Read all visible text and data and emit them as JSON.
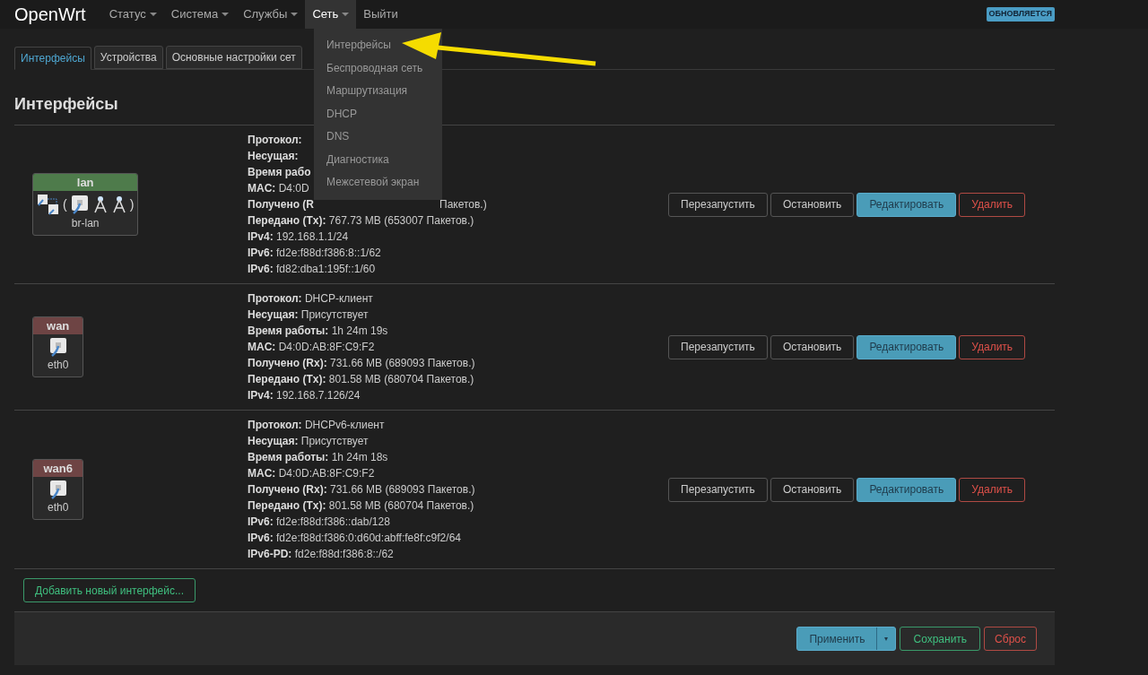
{
  "nav": {
    "brand": "OpenWrt",
    "menus": [
      {
        "label": "Статус",
        "caret": true,
        "open": false
      },
      {
        "label": "Система",
        "caret": true,
        "open": false
      },
      {
        "label": "Службы",
        "caret": true,
        "open": false
      },
      {
        "label": "Сеть",
        "caret": true,
        "open": true
      },
      {
        "label": "Выйти",
        "caret": false,
        "open": false
      }
    ],
    "badge": "ОБНОВЛЯЕТСЯ"
  },
  "dropdown": [
    "Интерфейсы",
    "Беспроводная сеть",
    "Маршрутизация",
    "DHCP",
    "DNS",
    "Диагностика",
    "Межсетевой экран"
  ],
  "tabs": [
    {
      "label": "Интерфейсы",
      "selected": true
    },
    {
      "label": "Устройства",
      "selected": false
    },
    {
      "label": "Основные настройки сет",
      "selected": false
    }
  ],
  "heading": "Интерфейсы",
  "interfaces": [
    {
      "name": "lan",
      "color": "#4e7b4b",
      "device": "br-lan",
      "icons": [
        {
          "kind": "bridge"
        },
        {
          "kind": "paren",
          "text": "("
        },
        {
          "kind": "ethernet"
        },
        {
          "kind": "wifi"
        },
        {
          "kind": "wifi"
        },
        {
          "kind": "paren",
          "text": ")"
        }
      ],
      "info": [
        {
          "label": "Протокол:"
        },
        {
          "label": "Несущая:"
        },
        {
          "label": "Время рабо"
        },
        {
          "label": "MAC:",
          "value": "D4:0D"
        },
        {
          "label": "Получено (R",
          "tail": "Пакетов.)"
        },
        {
          "label": "Передано (Tx):",
          "value": "767.73 MB (653007 Пакетов.)"
        },
        {
          "label": "IPv4:",
          "value": "192.168.1.1/24"
        },
        {
          "label": "IPv6:",
          "value": "fd2e:f88d:f386:8::1/62"
        },
        {
          "label": "IPv6:",
          "value": "fd82:dba1:195f::1/60"
        }
      ]
    },
    {
      "name": "wan",
      "color": "#6e4444",
      "device": "eth0",
      "icons": [
        {
          "kind": "ethernet"
        }
      ],
      "info": [
        {
          "label": "Протокол:",
          "value": "DHCP-клиент"
        },
        {
          "label": "Несущая:",
          "value": "Присутствует"
        },
        {
          "label": "Время работы:",
          "value": "1h 24m 19s"
        },
        {
          "label": "MAC:",
          "value": "D4:0D:AB:8F:C9:F2"
        },
        {
          "label": "Получено (Rx):",
          "value": "731.66 MB (689093 Пакетов.)"
        },
        {
          "label": "Передано (Tx):",
          "value": "801.58 MB (680704 Пакетов.)"
        },
        {
          "label": "IPv4:",
          "value": "192.168.7.126/24"
        }
      ]
    },
    {
      "name": "wan6",
      "color": "#6e4444",
      "device": "eth0",
      "icons": [
        {
          "kind": "ethernet"
        }
      ],
      "info": [
        {
          "label": "Протокол:",
          "value": "DHCPv6-клиент"
        },
        {
          "label": "Несущая:",
          "value": "Присутствует"
        },
        {
          "label": "Время работы:",
          "value": "1h 24m 18s"
        },
        {
          "label": "MAC:",
          "value": "D4:0D:AB:8F:C9:F2"
        },
        {
          "label": "Получено (Rx):",
          "value": "731.66 MB (689093 Пакетов.)"
        },
        {
          "label": "Передано (Tx):",
          "value": "801.58 MB (680704 Пакетов.)"
        },
        {
          "label": "IPv6:",
          "value": "fd2e:f88d:f386::dab/128"
        },
        {
          "label": "IPv6:",
          "value": "fd2e:f88d:f386:0:d60d:abff:fe8f:c9f2/64"
        },
        {
          "label": "IPv6-PD:",
          "value": "fd2e:f88d:f386:8::/62"
        }
      ]
    }
  ],
  "row_buttons": [
    [
      {
        "label": "Перезапустить",
        "kind": "default"
      },
      {
        "label": "Остановить",
        "kind": "default"
      },
      {
        "label": "Редактировать",
        "kind": "primary"
      },
      {
        "label": "Удалить",
        "kind": "danger"
      }
    ],
    [
      {
        "label": "Перезапустить",
        "kind": "default"
      },
      {
        "label": "Остановить",
        "kind": "default"
      },
      {
        "label": "Редактировать",
        "kind": "primary"
      },
      {
        "label": "Удалить",
        "kind": "danger"
      }
    ],
    [
      {
        "label": "Перезапустить",
        "kind": "default"
      },
      {
        "label": "Остановить",
        "kind": "default"
      },
      {
        "label": "Редактировать",
        "kind": "primary"
      },
      {
        "label": "Удалить",
        "kind": "danger"
      }
    ]
  ],
  "add_button": "Добавить новый интерфейс...",
  "footer": {
    "apply": "Применить",
    "apply_caret": "▾",
    "save": "Сохранить",
    "reset": "Сброс"
  }
}
